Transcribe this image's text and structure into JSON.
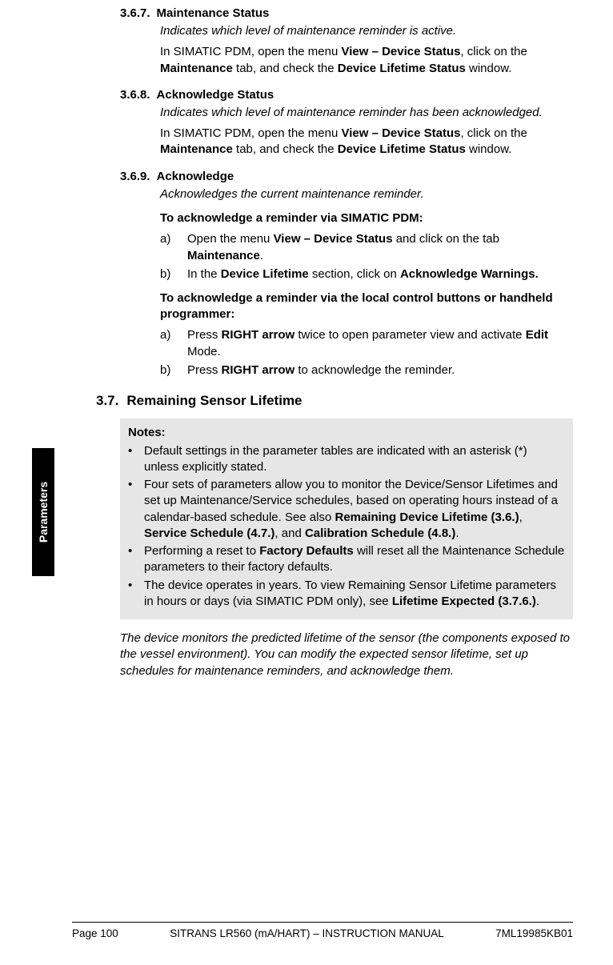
{
  "sidebar": {
    "label": "Parameters"
  },
  "s367": {
    "num": "3.6.7.",
    "title": "Maintenance Status",
    "desc": "Indicates which level of maintenance reminder is active.",
    "body_pre": "In SIMATIC PDM, open the menu ",
    "b1": "View – Device Status",
    "body_mid1": ", click on the ",
    "b2": "Maintenance",
    "body_mid2": " tab, and check the ",
    "b3": "Device Lifetime Status",
    "body_end": " window."
  },
  "s368": {
    "num": "3.6.8.",
    "title": "Acknowledge Status",
    "desc": "Indicates which level of maintenance reminder has been acknowledged.",
    "body_pre": "In SIMATIC PDM, open the menu ",
    "b1": "View – Device Status",
    "body_mid1": ", click on the ",
    "b2": "Maintenance",
    "body_mid2": " tab, and check the ",
    "b3": "Device Lifetime Status",
    "body_end": " window."
  },
  "s369": {
    "num": "3.6.9.",
    "title": "Acknowledge",
    "desc": "Acknowledges the current maintenance reminder.",
    "proc1_title": "To acknowledge a reminder via SIMATIC PDM:",
    "proc1_a_lbl": "a)",
    "proc1_a_pre": "Open the menu ",
    "proc1_a_b1": "View – Device Status",
    "proc1_a_mid": " and click on the tab ",
    "proc1_a_b2": "Maintenance",
    "proc1_a_end": ".",
    "proc1_b_lbl": "b)",
    "proc1_b_pre": "In the ",
    "proc1_b_b1": "Device Lifetime",
    "proc1_b_mid": " section, click on ",
    "proc1_b_b2": "Acknowledge Warnings.",
    "proc2_title": "To acknowledge a reminder via the local control buttons or handheld programmer:",
    "proc2_a_lbl": "a)",
    "proc2_a_pre": "Press ",
    "proc2_a_b1": "RIGHT arrow ",
    "proc2_a_mid": " twice to open parameter view and activate ",
    "proc2_a_b2": "Edit",
    "proc2_a_end": " Mode.",
    "proc2_b_lbl": "b)",
    "proc2_b_pre": "Press ",
    "proc2_b_b1": "RIGHT arrow ",
    "proc2_b_end": " to acknowledge the reminder."
  },
  "s37": {
    "num": "3.7.",
    "title": "Remaining Sensor Lifetime",
    "notes_title": "Notes:",
    "n1": "Default settings in the parameter tables are indicated with an asterisk (*) unless explicitly stated.",
    "n2_pre": "Four sets of parameters allow you to monitor the Device/Sensor Lifetimes and set up Maintenance/Service schedules, based on operating hours instead of a calendar-based schedule. See also ",
    "n2_b1": "Remaining Device Lifetime (3.6.)",
    "n2_sep1": ", ",
    "n2_b2": "Service Schedule (4.7.)",
    "n2_sep2": ", and ",
    "n2_b3": "Calibration Schedule (4.8.)",
    "n2_end": ".",
    "n3_pre": "Performing a reset to ",
    "n3_b1": "Factory Defaults",
    "n3_end": " will reset all the Maintenance Schedule parameters to their factory defaults.",
    "n4_pre": "The device operates in years. To view Remaining Sensor Lifetime parameters in hours or days (via SIMATIC PDM only), see ",
    "n4_b1": "Lifetime Expected (3.7.6.)",
    "n4_end": ".",
    "desc": "The device monitors the predicted lifetime of the sensor (the components exposed to the vessel environment). You can modify the expected sensor lifetime, set up schedules for maintenance reminders, and acknowledge them."
  },
  "footer": {
    "left": "Page 100",
    "center": "SITRANS LR560 (mA/HART) – INSTRUCTION MANUAL",
    "right": "7ML19985KB01"
  }
}
